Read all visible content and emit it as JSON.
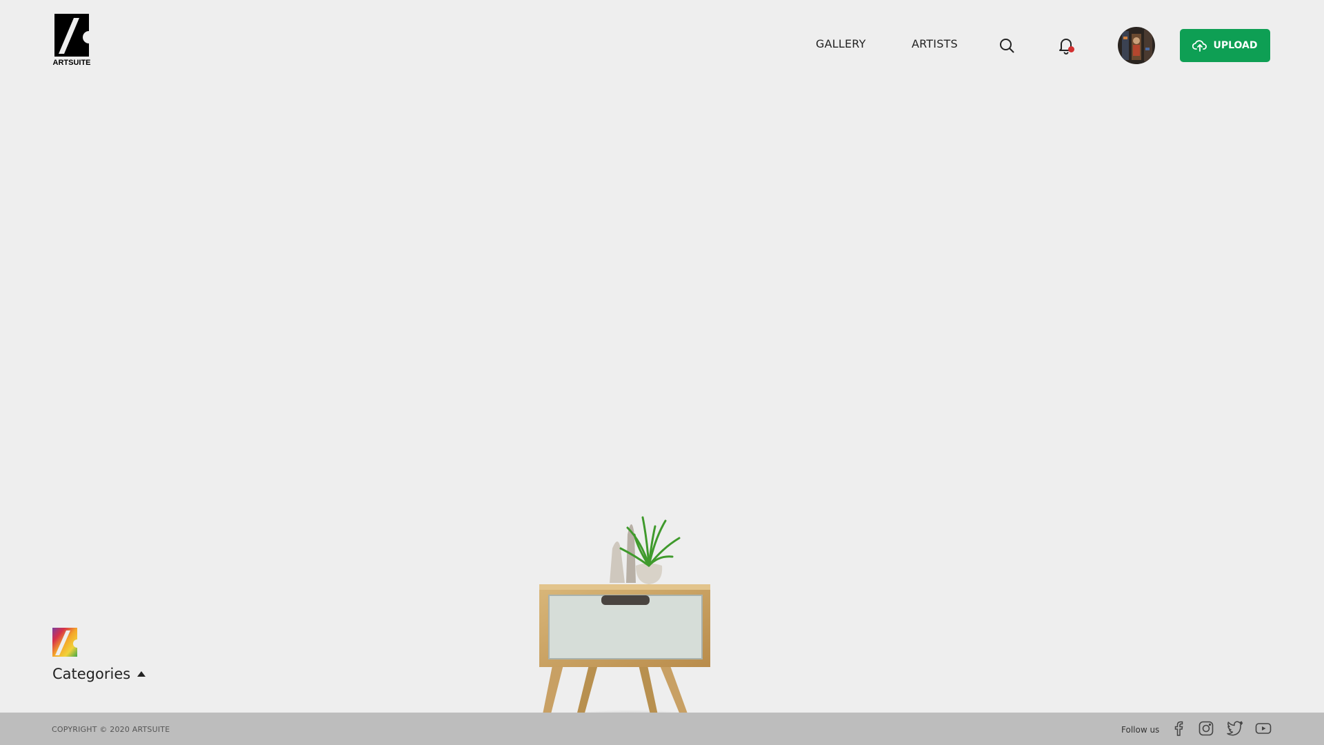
{
  "brand": {
    "logo_text": "ARTSUITE",
    "logo_icon": "artsuite-logo-icon"
  },
  "nav": {
    "gallery": "GALLERY",
    "artists": "ARTISTS",
    "search_icon": "search-icon",
    "notification_icon": "bell-icon",
    "notification_badge_color": "#d32f2f",
    "upload_label": "UPLOAD",
    "upload_icon": "cloud-upload-icon",
    "upload_color": "#0e9f54"
  },
  "main": {
    "categories_label": "Categories",
    "categories_toggle_icon": "caret-up-icon"
  },
  "footer": {
    "copyright": "COPYRIGHT © 2020 ARTSUITE",
    "follow_label": "Follow us",
    "social": [
      "facebook-icon",
      "instagram-icon",
      "twitter-icon",
      "youtube-icon"
    ]
  }
}
